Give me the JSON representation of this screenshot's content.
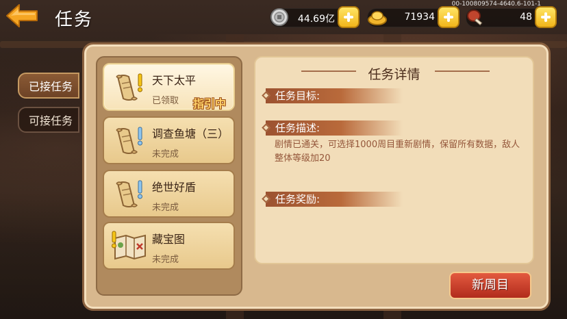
{
  "header": {
    "title": "任务",
    "debug_id": "00-100809574-4640.6-101-1"
  },
  "resources": {
    "silver": {
      "value": "44.69亿",
      "icon": "silver-coin-icon"
    },
    "gold": {
      "value": "71934",
      "icon": "gold-ingot-icon"
    },
    "food": {
      "value": "48",
      "icon": "meat-drumstick-icon"
    }
  },
  "side_tabs": [
    {
      "label": "已接任务",
      "active": true
    },
    {
      "label": "可接任务",
      "active": false
    }
  ],
  "quests": [
    {
      "title": "天下太平",
      "status": "已领取",
      "icon": "scroll-exclaim-icon",
      "selected": true
    },
    {
      "title": "调查鱼塘（三）",
      "status": "未完成",
      "icon": "scroll-exclaim-icon",
      "selected": false
    },
    {
      "title": "绝世好盾",
      "status": "未完成",
      "icon": "scroll-exclaim-icon",
      "selected": false
    },
    {
      "title": "藏宝图",
      "status": "未完成",
      "icon": "treasure-map-icon",
      "selected": false
    }
  ],
  "guide_tag": "指引中",
  "detail": {
    "title": "任务详情",
    "goal_label": "任务目标:",
    "desc_label": "任务描述:",
    "description": "剧情已通关，可选择1000周目重新剧情，保留所有数据，敌人整体等级加20",
    "reward_label": "任务奖励:"
  },
  "new_round_button": "新周目",
  "colors": {
    "panel": "#d8b88e",
    "detail_bg": "#f2ddb9",
    "button_red": "#c0392b",
    "plus_yellow": "#f7c928"
  }
}
